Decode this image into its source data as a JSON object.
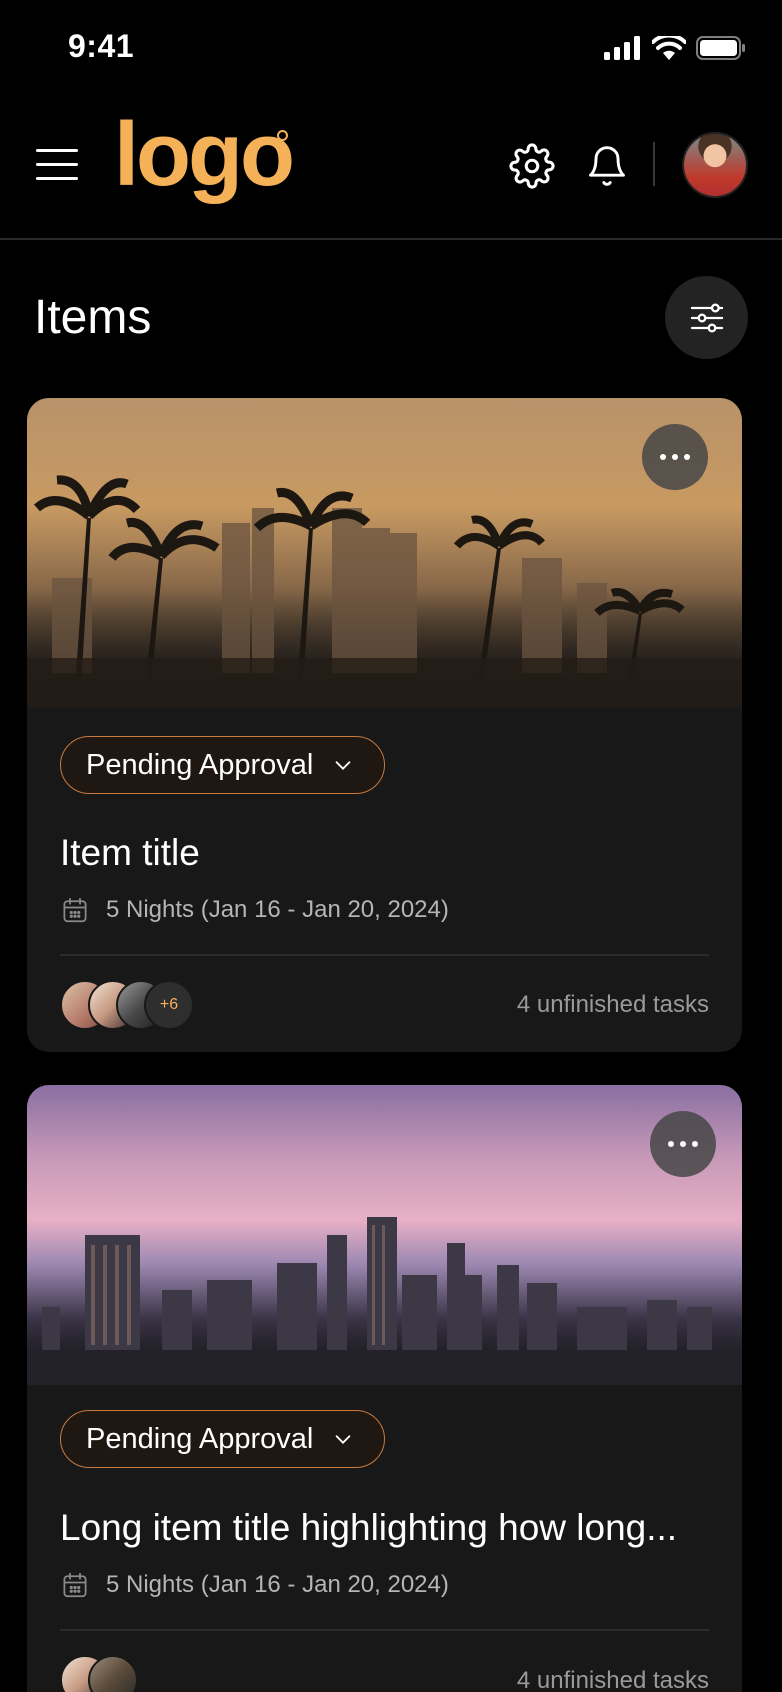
{
  "status_bar": {
    "time": "9:41"
  },
  "header": {
    "logo_text": "logo",
    "menu_icon": "hamburger-menu-icon",
    "settings_icon": "gear-icon",
    "notifications_icon": "bell-icon"
  },
  "page": {
    "title": "Items",
    "filter_icon": "sliders-icon"
  },
  "colors": {
    "accent": "#f5b158",
    "pill_border": "#c97a3c",
    "card_bg": "#181818",
    "background": "#000000"
  },
  "cards": [
    {
      "status": "Pending Approval",
      "title": "Item title",
      "dates": "5 Nights (Jan 16 - Jan 20, 2024)",
      "extra_members": "+6",
      "tasks": "4 unfinished tasks"
    },
    {
      "status": "Pending Approval",
      "title": "Long item title highlighting how long...",
      "dates": "5 Nights (Jan 16 - Jan 20, 2024)",
      "tasks": "4 unfinished tasks"
    }
  ]
}
